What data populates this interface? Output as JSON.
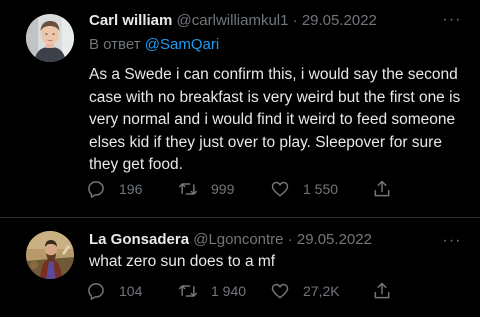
{
  "tweets": [
    {
      "display_name": "Carl william",
      "handle": "@carlwilliamkul1",
      "separator": "·",
      "date": "29.05.2022",
      "reply_prefix": "В ответ",
      "reply_handle": "@SamQari",
      "text": "As a Swede i can confirm this, i would say the second case with no breakfast is very weird but the first one is very normal and i would find it weird to feed someone elses kid if they just over to play. Sleepover for sure they get food.",
      "replies": "196",
      "retweets": "999",
      "likes": "1 550",
      "more_glyph": "···"
    },
    {
      "display_name": "La Gonsadera",
      "handle": "@Lgoncontre",
      "separator": "·",
      "date": "29.05.2022",
      "text": "what zero sun does to a mf",
      "replies": "104",
      "retweets": "1 940",
      "likes": "27,2K",
      "more_glyph": "···"
    }
  ],
  "icons": {
    "reply": "reply-icon",
    "retweet": "retweet-icon",
    "like": "heart-icon",
    "share": "share-icon",
    "more": "more-icon"
  },
  "colors": {
    "background": "#000000",
    "text": "#e7e9ea",
    "muted": "#71767b",
    "link": "#1d9bf0",
    "divider": "#2f3336"
  }
}
